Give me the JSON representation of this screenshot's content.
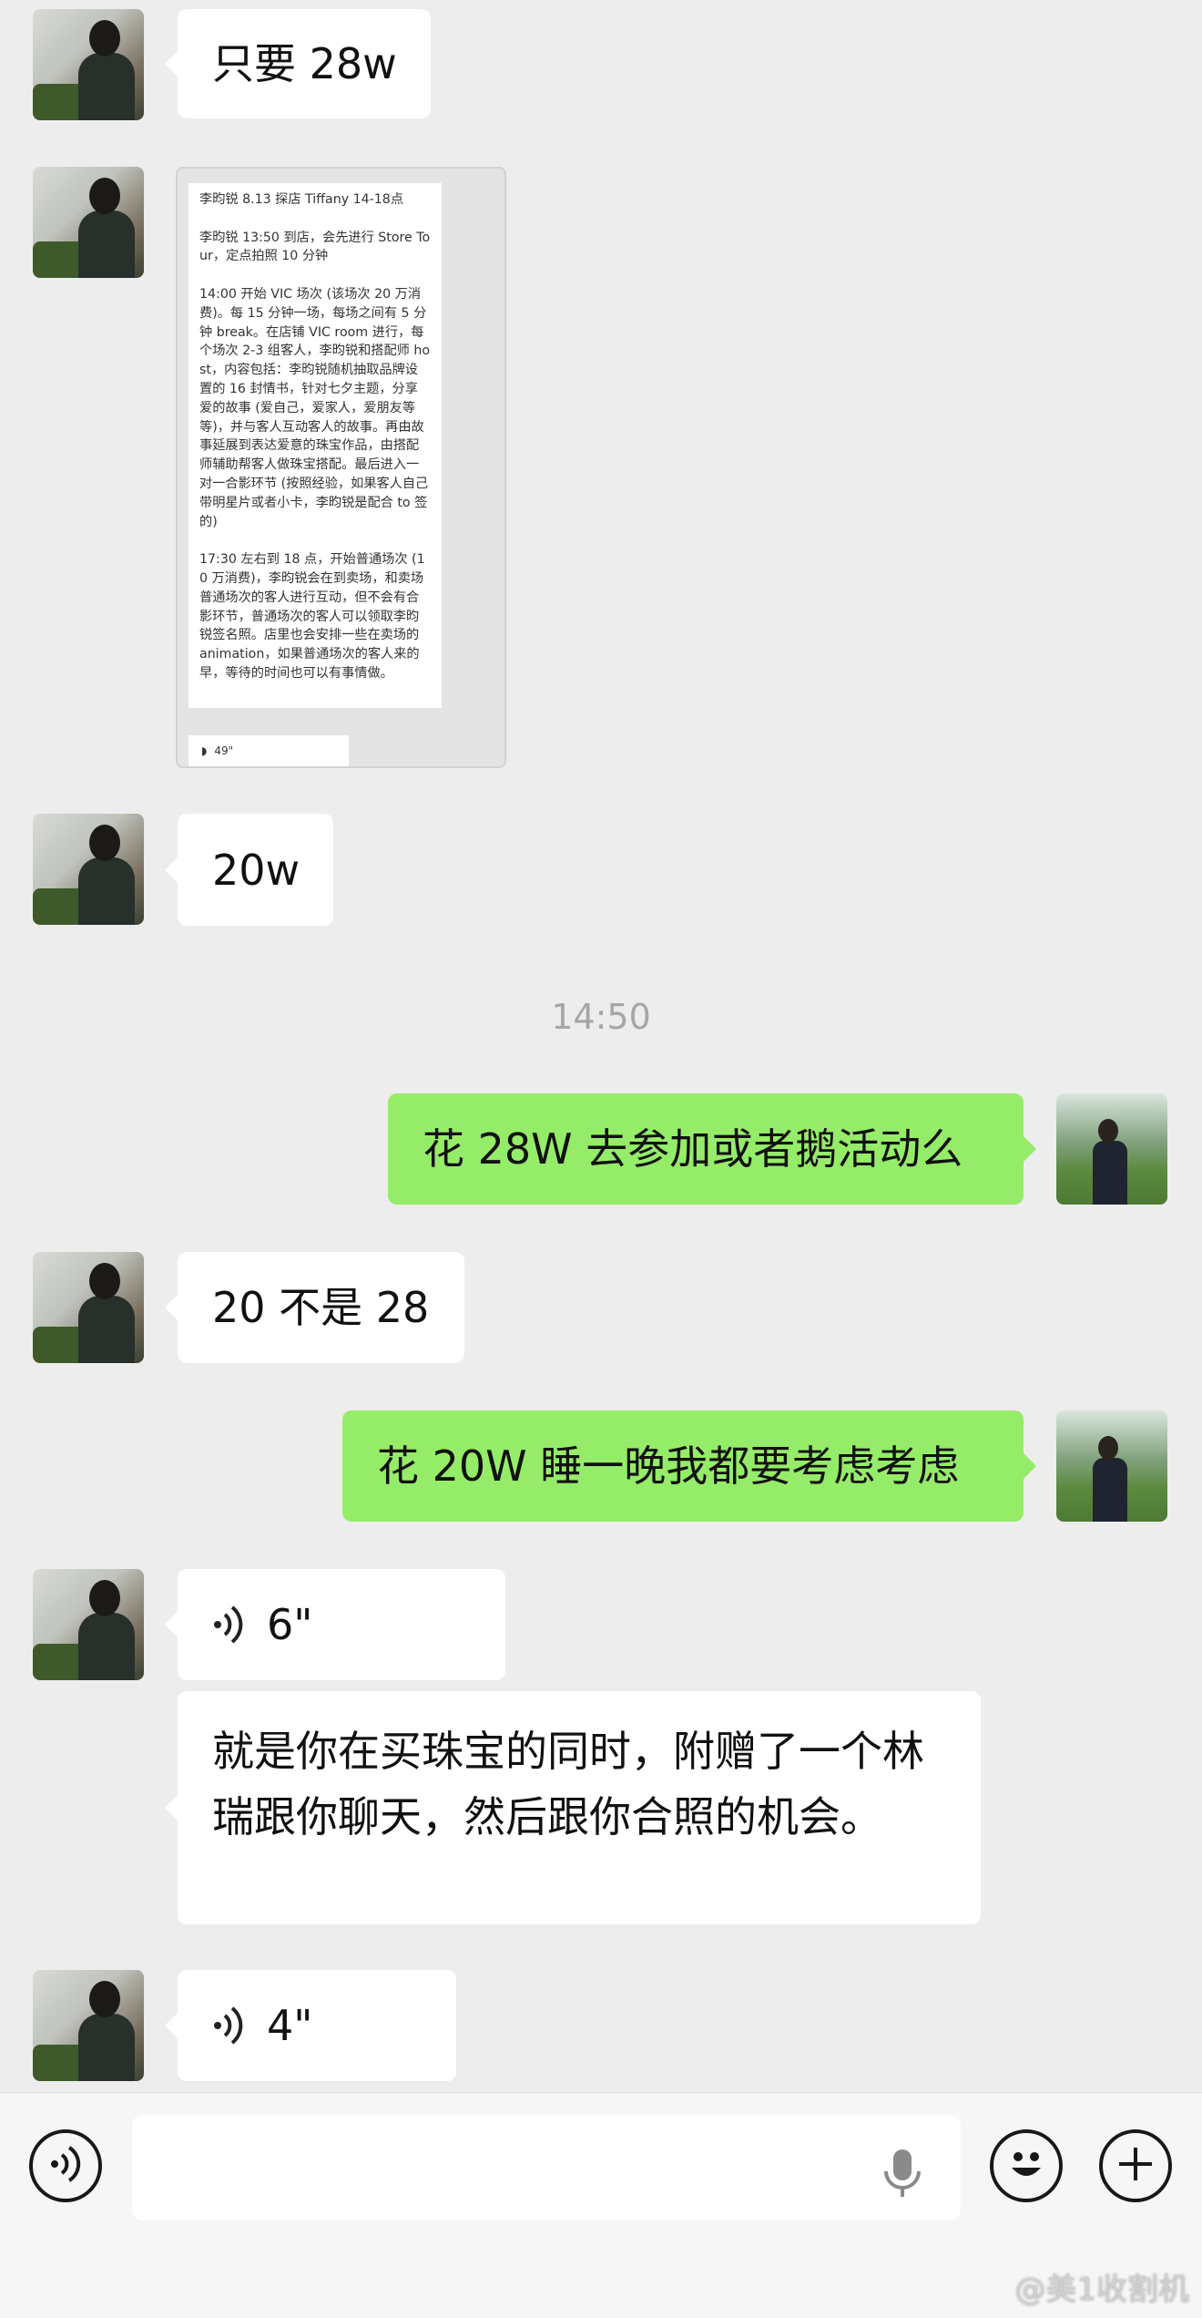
{
  "messages": {
    "m1": "只要 28w",
    "m2_image_text": "李昀锐 8.13 探店 Tiffany 14-18点\n\n李昀锐 13:50 到店，会先进行 Store Tour，定点拍照 10 分钟\n\n14:00 开始 VIC 场次 (该场次 20 万消费)。每 15 分钟一场，每场之间有 5 分钟 break。在店铺 VIC room 进行，每个场次 2-3 组客人，李昀锐和搭配师 host，内容包括：李昀锐随机抽取品牌设置的 16 封情书，针对七夕主题，分享爱的故事 (爱自己，爱家人，爱朋友等等)，并与客人互动客人的故事。再由故事延展到表达爱意的珠宝作品，由搭配师辅助帮客人做珠宝搭配。最后进入一对一合影环节 (按照经验，如果客人自己带明星片或者小卡，李昀锐是配合 to 签的)\n\n17:30 左右到 18 点，开始普通场次 (10 万消费)，李昀锐会在到卖场，和卖场普通场次的客人进行互动，但不会有合影环节，普通场次的客人可以领取李昀锐签名照。店里也会安排一些在卖场的 animation，如果普通场次的客人来的早，等待的时间也可以有事情做。",
    "m2_voice_mini": "49\"",
    "m3": "20w",
    "time": "14:50",
    "m4": "花 28W 去参加或者鹅活动么",
    "m5": "20 不是 28",
    "m6": "花 20W 睡一晚我都要考虑考虑",
    "m7_voice": "6\"",
    "m8": "就是你在买珠宝的同时，附赠了一个林瑞跟你聊天，然后跟你合照的机会。",
    "m9_voice": "4\""
  },
  "watermark": "@美1收割机",
  "colors": {
    "self_bubble": "#95ec69",
    "other_bubble": "#ffffff",
    "background": "#ededed"
  },
  "icons": [
    "voice-mode-icon",
    "microphone-icon",
    "emoji-icon",
    "plus-icon",
    "voice-wave-icon"
  ]
}
